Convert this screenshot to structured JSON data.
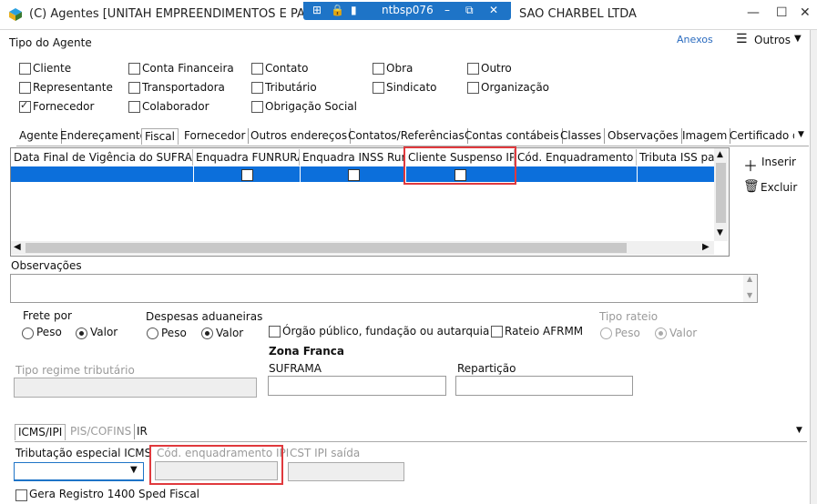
{
  "window": {
    "title": "(C) Agentes [UNITAH EMPREENDIMENTOS E PARTICI... SAO CHARBEL LTDA",
    "title_left": "(C) Agentes [UNITAH EMPREENDIMENTOS E PARTIC",
    "title_right": "SAO CHARBEL LTDA",
    "rdp_host": "ntbsp076"
  },
  "header": {
    "tipo_label": "Tipo do Agente",
    "anexos": "Anexos",
    "outros": "Outros"
  },
  "tipos": [
    {
      "label": "Cliente",
      "checked": false
    },
    {
      "label": "Conta Financeira",
      "checked": false
    },
    {
      "label": "Contato",
      "checked": false
    },
    {
      "label": "Obra",
      "checked": false
    },
    {
      "label": "Outro",
      "checked": false
    },
    {
      "label": "Representante",
      "checked": false
    },
    {
      "label": "Transportadora",
      "checked": false
    },
    {
      "label": "Tributário",
      "checked": false
    },
    {
      "label": "Sindicato",
      "checked": false
    },
    {
      "label": "Organização",
      "checked": false
    },
    {
      "label": "Fornecedor",
      "checked": true
    },
    {
      "label": "Colaborador",
      "checked": false
    },
    {
      "label": "Obrigação Social",
      "checked": false
    }
  ],
  "tabs": [
    "Agente",
    "Endereçamento",
    "Fiscal",
    "Fornecedor",
    "Outros endereços",
    "Contatos/Referências",
    "Contas contábeis",
    "Classes",
    "Observações",
    "Imagem",
    "Certificado d"
  ],
  "grid": {
    "columns": [
      "Data Final de Vigência do SUFRAMA",
      "Enquadra FUNRURAL",
      "Enquadra INSS Rural",
      "Cliente Suspenso IPI",
      "Cód. Enquadramento IPI",
      "Tributa ISS par"
    ]
  },
  "side": {
    "inserir": "Inserir",
    "excluir": "Excluir"
  },
  "observacoes": {
    "label": "Observações",
    "value": ""
  },
  "frete": {
    "label": "Frete por",
    "options": [
      "Peso",
      "Valor"
    ],
    "selected": "Valor"
  },
  "despesas": {
    "label": "Despesas aduaneiras",
    "options": [
      "Peso",
      "Valor"
    ],
    "selected": "Valor"
  },
  "orgao": {
    "label": "Órgão público, fundação ou autarquia",
    "checked": false
  },
  "rateio_afrmm": {
    "label": "Rateio AFRMM",
    "checked": false
  },
  "tipo_rateio": {
    "label": "Tipo rateio",
    "options": [
      "Peso",
      "Valor"
    ],
    "selected": "Valor"
  },
  "zona_franca": {
    "label": "Zona Franca",
    "suframa_label": "SUFRAMA",
    "suframa": "",
    "reparticao_label": "Repartição",
    "reparticao": ""
  },
  "tipo_regime": {
    "label": "Tipo regime tributário",
    "value": ""
  },
  "bottom_tabs": [
    "ICMS/IPI",
    "PIS/COFINS",
    "IR"
  ],
  "tributacao": {
    "label": "Tributação especial ICMS",
    "value": ""
  },
  "cod_enq_ipi": {
    "label": "Cód. enquadramento IPI",
    "value": ""
  },
  "cst_ipi": {
    "label": "CST IPI saída",
    "value": ""
  },
  "gera_registro": {
    "label": "Gera Registro 1400 Sped Fiscal",
    "checked": false
  }
}
